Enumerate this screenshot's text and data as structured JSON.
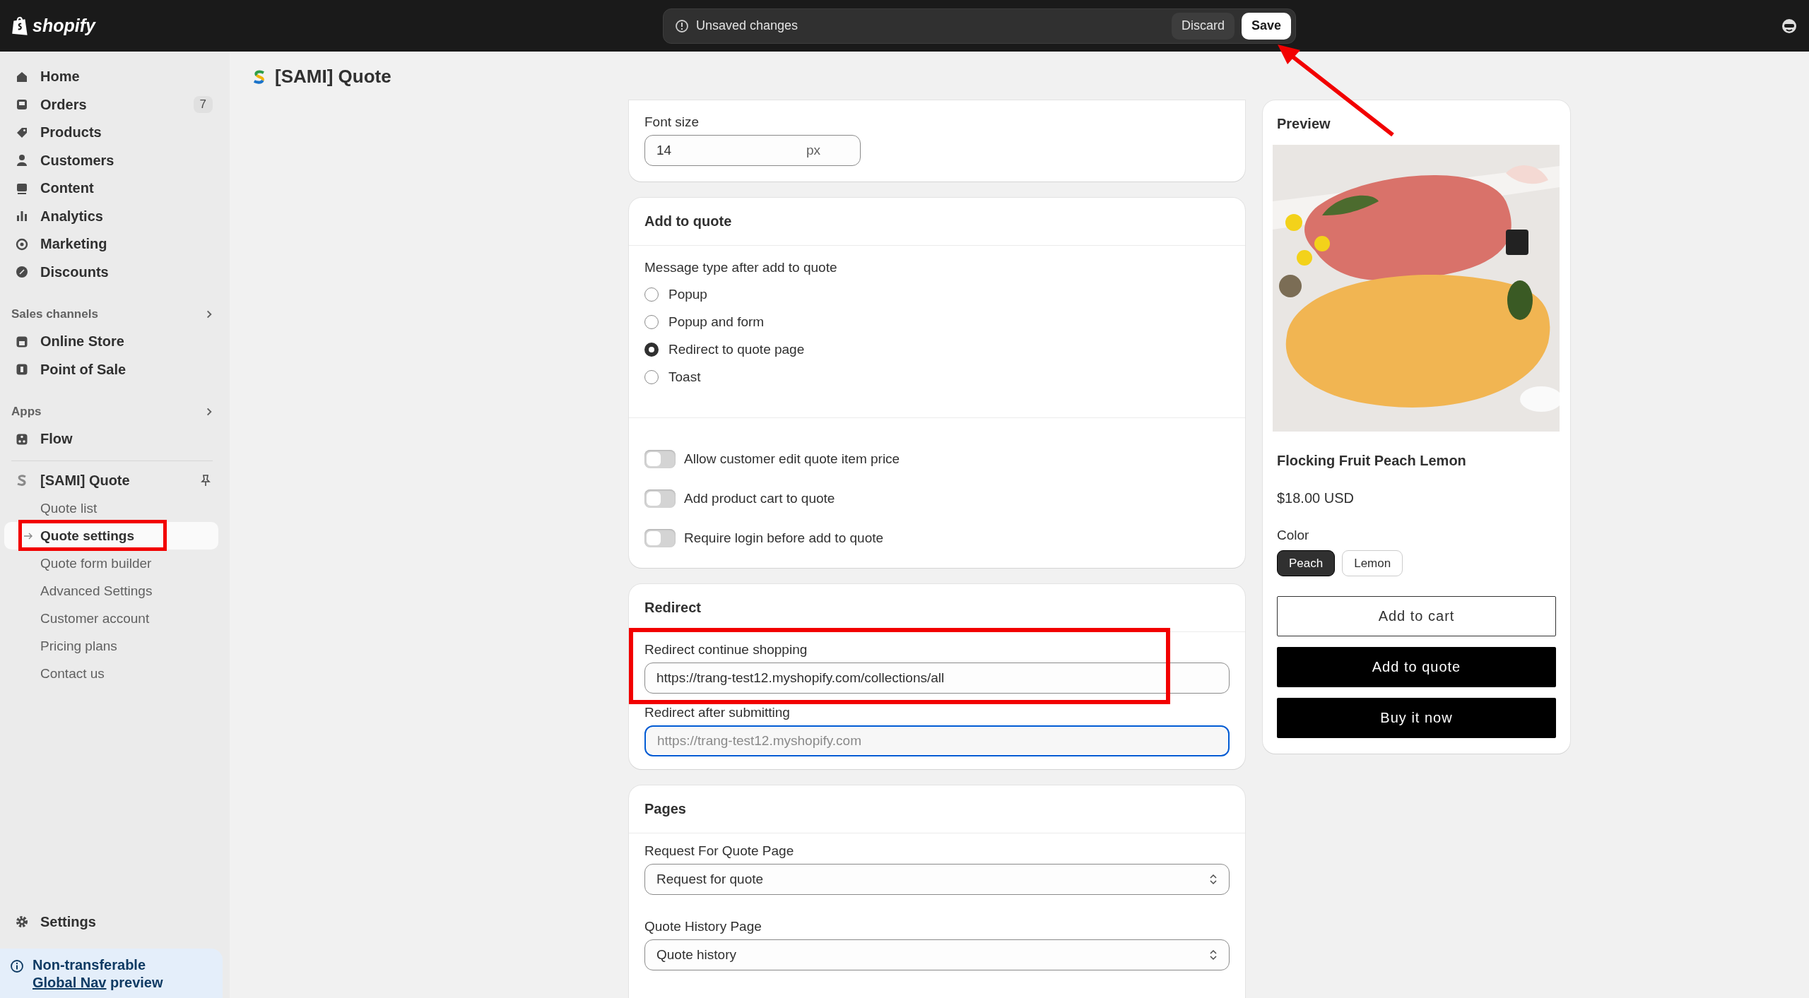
{
  "top_bar": {
    "logo": "shopify",
    "message": "Unsaved changes",
    "buttons": [
      {
        "label": "Discard",
        "kind": "secondary",
        "annotated": false
      },
      {
        "label": "Save",
        "kind": "primary",
        "annotated": true
      }
    ]
  },
  "sidebar": {
    "main_items": [
      {
        "label": "Home"
      },
      {
        "label": "Orders",
        "badge": "7"
      },
      {
        "label": "Products"
      },
      {
        "label": "Customers"
      },
      {
        "label": "Content"
      },
      {
        "label": "Analytics"
      },
      {
        "label": "Marketing"
      },
      {
        "label": "Discounts"
      }
    ],
    "sections": [
      {
        "title": "Sales channels",
        "items": [
          {
            "label": "Online Store"
          },
          {
            "label": "Point of Sale"
          }
        ]
      },
      {
        "title": "Apps",
        "items": [
          {
            "label": "Flow"
          }
        ]
      }
    ],
    "app": {
      "name": "[SAMI] Quote",
      "sub_items": [
        {
          "label": "Quote list",
          "selected": false,
          "annotated": false
        },
        {
          "label": "Quote settings",
          "selected": true,
          "annotated": true
        },
        {
          "label": "Quote form builder",
          "selected": false,
          "annotated": false
        },
        {
          "label": "Advanced Settings",
          "selected": false,
          "annotated": false
        },
        {
          "label": "Customer account",
          "selected": false,
          "annotated": false
        },
        {
          "label": "Pricing plans",
          "selected": false,
          "annotated": false
        },
        {
          "label": "Contact us",
          "selected": false,
          "annotated": false
        }
      ]
    },
    "settings": "Settings",
    "banner": {
      "title": "Non-transferable",
      "link": "Global Nav",
      "text": "preview"
    }
  },
  "page": {
    "title": "[SAMI] Quote"
  },
  "font_card": {
    "label": "Font size",
    "value": "14",
    "suffix": "px"
  },
  "add_to_quote": {
    "title": "Add to quote",
    "message_label": "Message type after add to quote",
    "options": [
      {
        "label": "Popup",
        "selected": false
      },
      {
        "label": "Popup and form",
        "selected": false
      },
      {
        "label": "Redirect to quote page",
        "selected": true
      },
      {
        "label": "Toast",
        "selected": false
      }
    ],
    "toggles": [
      {
        "label": "Allow customer edit quote item price",
        "on": false
      },
      {
        "label": "Add product cart to quote",
        "on": false
      },
      {
        "label": "Require login before add to quote",
        "on": false
      }
    ]
  },
  "redirect": {
    "title": "Redirect",
    "fields": [
      {
        "label": "Redirect continue shopping",
        "value": "https://trang-test12.myshopify.com/collections/all",
        "focused": false,
        "annotated": true
      },
      {
        "label": "Redirect after submitting",
        "placeholder": "https://trang-test12.myshopify.com",
        "focused": true,
        "annotated": false
      }
    ]
  },
  "pages": {
    "title": "Pages",
    "selects": [
      {
        "label": "Request For Quote Page",
        "value": "Request for quote"
      },
      {
        "label": "Quote History Page",
        "value": "Quote history"
      }
    ]
  },
  "preview": {
    "title": "Preview",
    "product": "Flocking Fruit Peach Lemon",
    "price": "$18.00 USD",
    "color_label": "Color",
    "options": [
      {
        "label": "Peach",
        "selected": true
      },
      {
        "label": "Lemon",
        "selected": false
      }
    ],
    "buttons": [
      {
        "label": "Add to cart",
        "kind": "outline"
      },
      {
        "label": "Add to quote",
        "kind": "solid"
      },
      {
        "label": "Buy it now",
        "kind": "solid"
      }
    ]
  }
}
